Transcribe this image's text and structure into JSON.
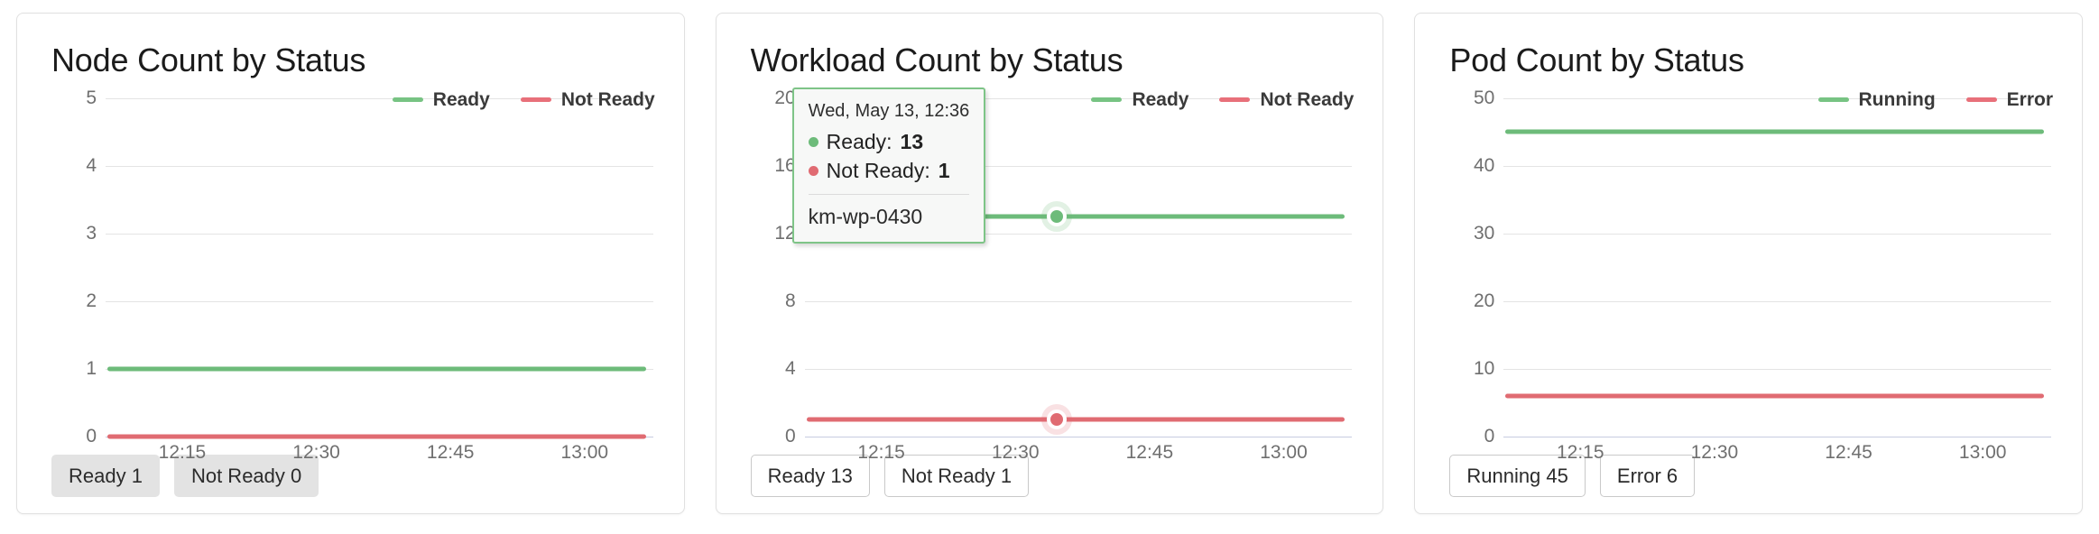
{
  "colors": {
    "green": "#6dbb7a",
    "red": "#e06b72",
    "legend_green": "#77c383",
    "legend_red": "#e8707a",
    "grid": "#e4e4e4",
    "axis": "#c7cbe0",
    "tooltip_border": "#7ec487",
    "tooltip_bg": "#f7f8f7",
    "chip_filled_bg": "#e3e3e3",
    "chip_outline_border": "#c9c9c9",
    "card_border": "#e0e0e0",
    "tick_text": "#6f6f6f",
    "title_text": "#1b1b1b"
  },
  "cards": [
    {
      "title": "Node Count by Status",
      "legend": [
        {
          "label": "Ready",
          "color": "#77c383"
        },
        {
          "label": "Not Ready",
          "color": "#e8707a"
        }
      ],
      "buttons": [
        {
          "label": "Ready 1",
          "style": "filled"
        },
        {
          "label": "Not Ready 0",
          "style": "filled"
        }
      ]
    },
    {
      "title": "Workload Count by Status",
      "legend": [
        {
          "label": "Ready",
          "color": "#77c383"
        },
        {
          "label": "Not Ready",
          "color": "#e8707a"
        }
      ],
      "buttons": [
        {
          "label": "Ready 13",
          "style": "outlined"
        },
        {
          "label": "Not Ready 1",
          "style": "outlined"
        }
      ],
      "tooltip": {
        "date": "Wed, May 13, 12:36",
        "rows": [
          {
            "name": "Ready:",
            "value": "13",
            "color": "#6dbb7a"
          },
          {
            "name": "Not Ready:",
            "value": "1",
            "color": "#e06b72"
          }
        ],
        "footer": "km-wp-0430"
      }
    },
    {
      "title": "Pod Count by Status",
      "legend": [
        {
          "label": "Running",
          "color": "#77c383"
        },
        {
          "label": "Error",
          "color": "#e8707a"
        }
      ],
      "buttons": [
        {
          "label": "Running 45",
          "style": "outlined"
        },
        {
          "label": "Error 6",
          "style": "outlined"
        }
      ]
    }
  ],
  "chart_data": [
    {
      "type": "line",
      "title": "Node Count by Status",
      "xlabel": "",
      "ylabel": "",
      "ylim": [
        0,
        5
      ],
      "yticks": [
        0,
        1,
        2,
        3,
        4,
        5
      ],
      "xticks": [
        "12:15",
        "12:30",
        "12:45",
        "13:00"
      ],
      "grid": true,
      "legend_position": "top-right",
      "series": [
        {
          "name": "Ready",
          "color": "#6dbb7a",
          "constant_value": 1,
          "values": [
            1,
            1,
            1,
            1,
            1
          ]
        },
        {
          "name": "Not Ready",
          "color": "#e06b72",
          "constant_value": 0,
          "values": [
            0,
            0,
            0,
            0,
            0
          ]
        }
      ]
    },
    {
      "type": "line",
      "title": "Workload Count by Status",
      "xlabel": "",
      "ylabel": "",
      "ylim": [
        0,
        20
      ],
      "yticks": [
        0,
        4,
        8,
        12,
        16,
        20
      ],
      "xticks": [
        "12:15",
        "12:30",
        "12:45",
        "13:00"
      ],
      "grid": true,
      "legend_position": "top-right",
      "series": [
        {
          "name": "Ready",
          "color": "#6dbb7a",
          "constant_value": 13,
          "values": [
            13,
            13,
            13,
            13,
            13
          ]
        },
        {
          "name": "Not Ready",
          "color": "#e06b72",
          "constant_value": 1,
          "values": [
            1,
            1,
            1,
            1,
            1
          ]
        }
      ],
      "hover": {
        "time": "Wed, May 13, 12:36",
        "ready": 13,
        "not_ready": 1,
        "label": "km-wp-0430"
      }
    },
    {
      "type": "line",
      "title": "Pod Count by Status",
      "xlabel": "",
      "ylabel": "",
      "ylim": [
        0,
        50
      ],
      "yticks": [
        0,
        10,
        20,
        30,
        40,
        50
      ],
      "xticks": [
        "12:15",
        "12:30",
        "12:45",
        "13:00"
      ],
      "grid": true,
      "legend_position": "top-right",
      "series": [
        {
          "name": "Running",
          "color": "#6dbb7a",
          "constant_value": 45,
          "values": [
            45,
            45,
            45,
            45,
            45
          ]
        },
        {
          "name": "Error",
          "color": "#e06b72",
          "constant_value": 6,
          "values": [
            6,
            6,
            6,
            6,
            6
          ]
        }
      ]
    }
  ]
}
